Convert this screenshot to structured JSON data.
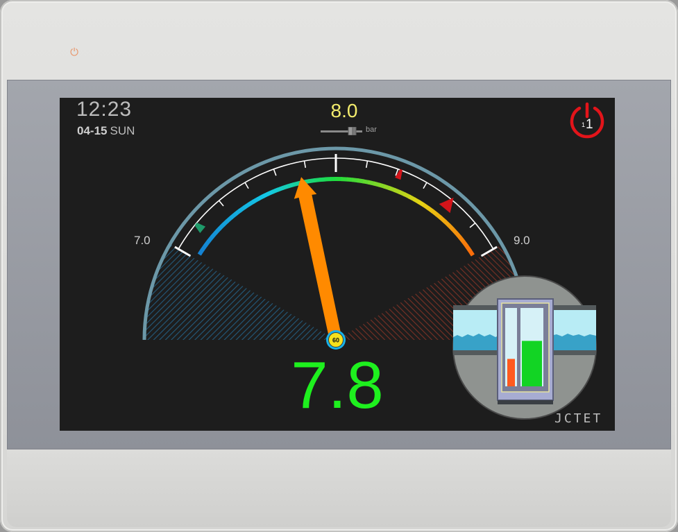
{
  "device": {
    "power_led_icon": "power-icon",
    "logo_text": "JCTET"
  },
  "status": {
    "time": "12:23",
    "date": "04-15",
    "weekday": "SUN"
  },
  "setpoint": {
    "value": "8.0",
    "unit": "bar",
    "value_color": "#f3ec6d"
  },
  "power_button": {
    "icon": "power-icon",
    "small_label": "1",
    "large_label": "1",
    "color": "#e2141a"
  },
  "gauge": {
    "min_label": "7.0",
    "max_label": "9.0",
    "min": 7.0,
    "max": 9.0,
    "value": 7.8,
    "readout": "7.8",
    "readout_color": "#1ef01e",
    "hub_label": "60",
    "needle_color": "#ff8a00",
    "marker_low": 7.16,
    "marker_high_1": 8.35,
    "marker_high_2": 8.66
  },
  "tank_inset": {
    "icon": "tank-level-icon",
    "left_bar_level": 0.35,
    "right_bar_level": 0.58,
    "left_bar_color": "#ff5a1f",
    "right_bar_color": "#12d424"
  }
}
